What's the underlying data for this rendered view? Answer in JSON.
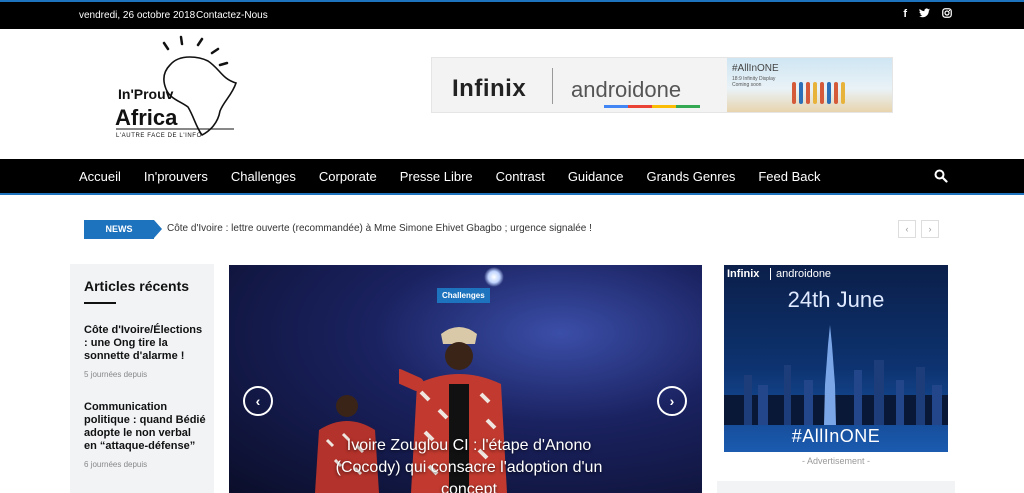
{
  "topbar": {
    "date": "vendredi, 26 octobre 2018",
    "contact": "Contactez-Nous",
    "social": [
      "f",
      "t",
      "ig"
    ]
  },
  "logo": {
    "line1": "In'Prouv",
    "line2": "Africa",
    "tagline": "L'AUTRE FACE DE L'INFO"
  },
  "header_ad": {
    "brand1": "Infinix",
    "brand2": "androidone",
    "tag": "#AllInONE",
    "sub1": "18:9 Infinity Display",
    "sub2": "Coming soon"
  },
  "nav": {
    "items": [
      "Accueil",
      "In'prouvers",
      "Challenges",
      "Corporate",
      "Presse Libre",
      "Contrast",
      "Guidance",
      "Grands Genres",
      "Feed Back"
    ],
    "active": "Accueil"
  },
  "ticker": {
    "label": "NEWS",
    "headline": "Côte d'Ivoire : lettre ouverte (recommandée) à Mme Simone Ehivet Gbagbo ; urgence signalée !",
    "prev": "‹",
    "next": "›"
  },
  "sidebar": {
    "title": "Articles récents",
    "articles": [
      {
        "title": "Côte d'Ivoire/Élections : une Ong tire la sonnette d'alarme !",
        "time": "5 journées depuis"
      },
      {
        "title": "Communication politique : quand Bédié adopte le non verbal en “attaque-défense”",
        "time": "6 journées depuis"
      }
    ]
  },
  "slider": {
    "category": "Challenges",
    "title": "Ivoire Zouglou CI : l'étape d'Anono (Cocody) qui consacre l'adoption d'un concept",
    "prev": "‹",
    "next": "›"
  },
  "right_ad": {
    "brand1": "Infinix",
    "brand2": "androidone",
    "date": "24th June",
    "hashtag": "#AllInONE",
    "label": "- Advertisement -"
  },
  "colors": {
    "accent": "#1e73be",
    "bar": "#000000",
    "sidebar_bg": "#f1f3f5"
  }
}
